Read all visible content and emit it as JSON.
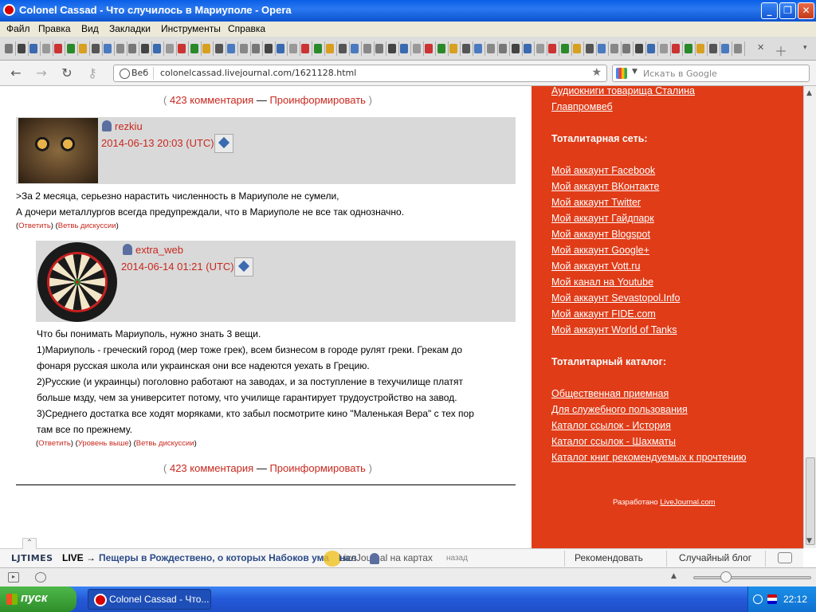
{
  "window": {
    "title": "Colonel Cassad - Что случилось в Мариуполе - Opera",
    "buttons": {
      "minimize": "_",
      "maximize": "❐",
      "close": "✕"
    }
  },
  "menu": [
    "Файл",
    "Правка",
    "Вид",
    "Закладки",
    "Инструменты",
    "Справка"
  ],
  "address": {
    "web_label": "Веб",
    "url": "colonelcassad.livejournal.com/1621128.html",
    "search_placeholder": "Искать в Google"
  },
  "post_links": {
    "comments": "423 комментария",
    "dash": "—",
    "inform": "Проинформировать",
    "open": "(",
    "close": ")"
  },
  "comments": [
    {
      "user": "rezkiu",
      "date": "2014-06-13 20:03 (UTC)",
      "lines": [
        ">За 2 месяца, серьезно нарастить численность в Мариуполе не сумели,",
        "А дочери металлургов всегда предупреждали, что в Мариуполе не все так однозначно."
      ],
      "actions": [
        "Ответить",
        "Ветвь дискуссии"
      ]
    },
    {
      "user": "extra_web",
      "date": "2014-06-14 01:21 (UTC)",
      "lines": [
        "Что бы понимать Мариуполь, нужно знать 3 вещи.",
        "1)Мариуполь - греческий город (мер тоже грек), всем бизнесом в городе рулят греки. Грекам до",
        "фонаря русская школа или украинская они все надеются уехать в Грецию.",
        "2)Русские (и украинцы) поголовно работают на заводах, и за поступление в техучилище платят",
        "больше мзду, чем за университет потому, что училище гарантирует трудоустройство на завод.",
        "3)Среднего достатка все ходят моряками, кто забыл посмотрите кино \"Маленькая Вера\" с тех пор",
        "там все по прежнему."
      ],
      "actions": [
        "Ответить",
        "Уровень выше",
        "Ветвь дискуссии"
      ]
    }
  ],
  "sidebar": {
    "top_links": [
      "Аудиокниги товарища Сталина",
      "Главпромвеб"
    ],
    "section1_title": "Тоталитарная сеть:",
    "section1_links": [
      "Мой аккаунт Facebook",
      "Мой аккаунт ВКонтакте",
      "Мой аккаунт Twitter",
      "Мой аккаунт Гайдпарк",
      "Мой аккаунт Blogspot",
      "Мой аккаунт Google+",
      "Мой аккаунт Vott.ru",
      "Мой канал на Youtube",
      "Мой аккаунт Sevastopol.Info",
      "Мой аккаунт FIDE.com",
      "Мой аккаунт World of Tanks"
    ],
    "section2_title": "Тоталитарный каталог:",
    "section2_links": [
      "Общественная приемная",
      "Для служебного пользования",
      "Каталог ссылок - История",
      "Каталог ссылок - Шахматы",
      "Каталог книг рекомендуемых к прочтению"
    ],
    "made_by_prefix": "Разработано",
    "made_by_link": "LiveJournal.com"
  },
  "ljtimes": {
    "brand": "LJTIMES",
    "live": "LIVE →",
    "headline": "Пещеры в Рождествено, о которых Набоков ума",
    "headline2": "нал",
    "overlay": "LiveJournal на картах",
    "ago": "назад",
    "recommend": "Рекомендовать",
    "random": "Случайный блог"
  },
  "taskbar": {
    "start": "пуск",
    "task": "Colonel Cassad - Что...",
    "clock": "22:12"
  }
}
